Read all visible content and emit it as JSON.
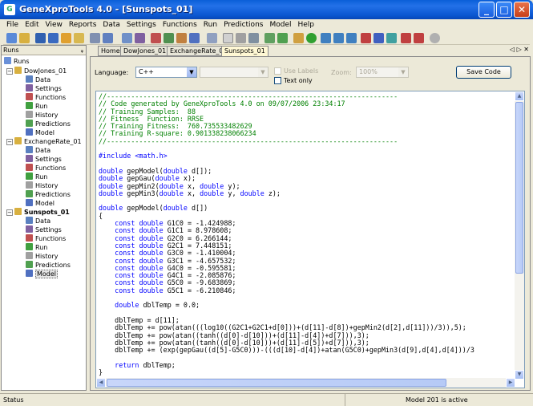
{
  "window": {
    "title": "GeneXproTools 4.0 - [Sunspots_01]"
  },
  "menu": [
    "File",
    "Edit",
    "View",
    "Reports",
    "Data",
    "Settings",
    "Functions",
    "Run",
    "Predictions",
    "Model",
    "Help"
  ],
  "runs_panel": {
    "title": "Runs",
    "root": "Runs",
    "runs": [
      {
        "name": "DowJones_01",
        "items": [
          "Data",
          "Settings",
          "Functions",
          "Run",
          "History",
          "Predictions",
          "Model"
        ]
      },
      {
        "name": "ExchangeRate_01",
        "items": [
          "Data",
          "Settings",
          "Functions",
          "Run",
          "History",
          "Predictions",
          "Model"
        ]
      },
      {
        "name": "Sunspots_01",
        "items": [
          "Data",
          "Settings",
          "Functions",
          "Run",
          "History",
          "Predictions",
          "Model"
        ]
      }
    ]
  },
  "tabs": [
    "Home",
    "DowJones_01",
    "ExchangeRate_01",
    "Sunspots_01"
  ],
  "tab_nav": "◁ ▷ ✕",
  "options": {
    "language_label": "Language:",
    "language_value": "C++",
    "use_labels": "Use Labels",
    "text_only": "Text only",
    "zoom_label": "Zoom:",
    "zoom_value": "100%",
    "save_code": "Save Code"
  },
  "code_lines": [
    [
      "cmt",
      "//------------------------------------------------------------------------"
    ],
    [
      "cmt",
      "// Code generated by GeneXproTools 4.0 on 09/07/2006 23:34:17"
    ],
    [
      "cmt",
      "// Training Samples:  88"
    ],
    [
      "cmt",
      "// Fitness  Function: RRSE"
    ],
    [
      "cmt",
      "// Training Fitness:  760.735533482629"
    ],
    [
      "cmt",
      "// Training R-square: 0.901338238066234"
    ],
    [
      "cmt",
      "//------------------------------------------------------------------------"
    ],
    [
      "",
      ""
    ],
    [
      "kw",
      "#include <math.h>"
    ],
    [
      "",
      ""
    ],
    [
      "",
      "double gepModel(double d[]);"
    ],
    [
      "",
      "double gepGau(double x);"
    ],
    [
      "",
      "double gepMin2(double x, double y);"
    ],
    [
      "",
      "double gepMin3(double x, double y, double z);"
    ],
    [
      "",
      ""
    ],
    [
      "",
      "double gepModel(double d[])"
    ],
    [
      "",
      "{"
    ],
    [
      "",
      "    const double G1C0 = -1.424988;"
    ],
    [
      "",
      "    const double G1C1 = 8.978608;"
    ],
    [
      "",
      "    const double G2C0 = 6.266144;"
    ],
    [
      "",
      "    const double G2C1 = 7.448151;"
    ],
    [
      "",
      "    const double G3C0 = -1.410004;"
    ],
    [
      "",
      "    const double G3C1 = -4.657532;"
    ],
    [
      "",
      "    const double G4C0 = -0.595581;"
    ],
    [
      "",
      "    const double G4C1 = -2.085876;"
    ],
    [
      "",
      "    const double G5C0 = -9.683869;"
    ],
    [
      "",
      "    const double G5C1 = -6.210846;"
    ],
    [
      "",
      ""
    ],
    [
      "",
      "    double dblTemp = 0.0;"
    ],
    [
      "",
      ""
    ],
    [
      "",
      "    dblTemp = d[11];"
    ],
    [
      "",
      "    dblTemp += pow(atan(((log10((G2C1+G2C1+d[0]))+(d[11]-d[8])+gepMin2(d[2],d[11]))/3)),5);"
    ],
    [
      "",
      "    dblTemp += pow(atan((tanh((d[0]-d[10]))+(d[11]-d[4])+d[7])),3);"
    ],
    [
      "",
      "    dblTemp += pow(atan((tanh((d[0]-d[10]))+(d[11]-d[5])+d[7])),3);"
    ],
    [
      "",
      "    dblTemp += (exp(gepGau((d[5]-G5C0)))-(((d[10]-d[4])+atan(G5C0)+gepMin3(d[9],d[4],d[4]))/3"
    ],
    [
      "",
      ""
    ],
    [
      "",
      "    return dblTemp;"
    ],
    [
      "",
      "}"
    ]
  ],
  "status": {
    "left": "Status",
    "right": "Model 201 is active"
  }
}
